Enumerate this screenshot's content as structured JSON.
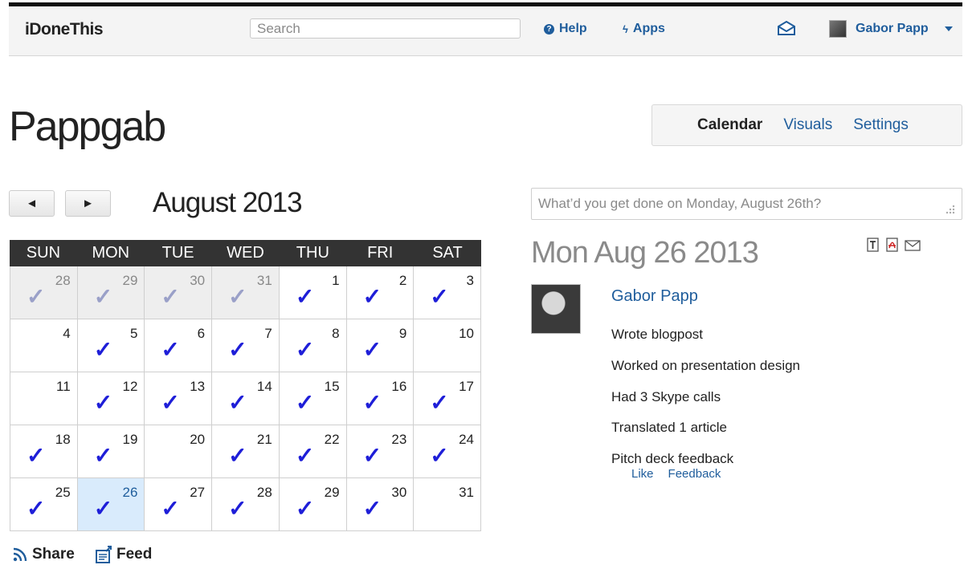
{
  "header": {
    "brand": "iDoneThis",
    "search_placeholder": "Search",
    "help_label": "Help",
    "apps_label": "Apps",
    "user_name": "Gabor Papp"
  },
  "page": {
    "title": "Pappgab",
    "tabs": [
      {
        "label": "Calendar",
        "active": true
      },
      {
        "label": "Visuals",
        "active": false
      },
      {
        "label": "Settings",
        "active": false
      }
    ]
  },
  "calendar": {
    "prev_label": "◄",
    "next_label": "►",
    "month_title": "August 2013",
    "weekdays": [
      "SUN",
      "MON",
      "TUE",
      "WED",
      "THU",
      "FRI",
      "SAT"
    ],
    "days": [
      {
        "n": "28",
        "other": true,
        "done": true
      },
      {
        "n": "29",
        "other": true,
        "done": true
      },
      {
        "n": "30",
        "other": true,
        "done": true
      },
      {
        "n": "31",
        "other": true,
        "done": true
      },
      {
        "n": "1",
        "done": true
      },
      {
        "n": "2",
        "done": true
      },
      {
        "n": "3",
        "done": true
      },
      {
        "n": "4",
        "done": false
      },
      {
        "n": "5",
        "done": true
      },
      {
        "n": "6",
        "done": true
      },
      {
        "n": "7",
        "done": true
      },
      {
        "n": "8",
        "done": true
      },
      {
        "n": "9",
        "done": true
      },
      {
        "n": "10",
        "done": false
      },
      {
        "n": "11",
        "done": false
      },
      {
        "n": "12",
        "done": true
      },
      {
        "n": "13",
        "done": true
      },
      {
        "n": "14",
        "done": true
      },
      {
        "n": "15",
        "done": true
      },
      {
        "n": "16",
        "done": true
      },
      {
        "n": "17",
        "done": true
      },
      {
        "n": "18",
        "done": true
      },
      {
        "n": "19",
        "done": true
      },
      {
        "n": "20",
        "done": false
      },
      {
        "n": "21",
        "done": true
      },
      {
        "n": "22",
        "done": true
      },
      {
        "n": "23",
        "done": true
      },
      {
        "n": "24",
        "done": true
      },
      {
        "n": "25",
        "done": true
      },
      {
        "n": "26",
        "done": true,
        "selected": true
      },
      {
        "n": "27",
        "done": true
      },
      {
        "n": "28",
        "done": true
      },
      {
        "n": "29",
        "done": true
      },
      {
        "n": "30",
        "done": true
      },
      {
        "n": "31",
        "done": false
      }
    ],
    "share_label": "Share",
    "feed_label": "Feed"
  },
  "entry": {
    "placeholder": "What’d you get done on Monday, August 26th?",
    "day_title": "Mon Aug 26 2013",
    "author": "Gabor Papp",
    "items": [
      "Wrote blogpost",
      "Worked on presentation design",
      "Had 3 Skype calls",
      "Translated 1 article",
      "Pitch deck feedback"
    ],
    "like_label": "Like",
    "feedback_label": "Feedback"
  },
  "colors": {
    "link": "#1f5d9c",
    "check": "#1e1ed8",
    "selected_day_bg": "#d9ebfc",
    "header_row_bg": "#333333"
  },
  "icons": [
    "help-icon",
    "bolt-icon",
    "mail-icon",
    "caret-down-icon",
    "rss-icon",
    "feed-icon",
    "text-doc-icon",
    "pdf-icon",
    "envelope-icon",
    "checkmark-icon",
    "resize-grip-icon"
  ]
}
